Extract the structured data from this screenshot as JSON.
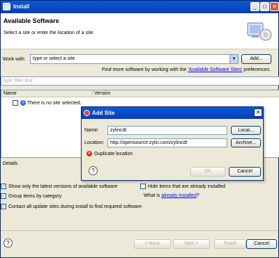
{
  "window": {
    "title": "Install",
    "minimize": "_",
    "maximize": "□",
    "close": "✕"
  },
  "header": {
    "title": "Available Software",
    "subtitle": "Select a site or enter the location of a site."
  },
  "work_with": {
    "label": "Work with:",
    "placeholder": "type or select a site",
    "add_button": "Add..."
  },
  "find_more": {
    "prefix": "Find more software by working with the ",
    "link": "'Available Software Sites'",
    "suffix": " preferences."
  },
  "filter": {
    "placeholder": "type filter text"
  },
  "table": {
    "columns": [
      "Name",
      "Version"
    ],
    "rows": [
      {
        "label": "There is no site selected."
      }
    ]
  },
  "details": {
    "label": "Details"
  },
  "options": {
    "show_latest": "Show only the latest versions of available software",
    "group_by_category": "Group items by category",
    "contact_update_sites": "Contact all update sites during install to find required software",
    "hide_installed": "Hide items that are already installed",
    "what_is_prefix": "What is ",
    "what_is_link": "already installed",
    "what_is_suffix": "?"
  },
  "wizard_buttons": {
    "back": "< Back",
    "next": "Next >",
    "finish": "Finish",
    "cancel": "Cancel"
  },
  "add_site_dialog": {
    "title": "Add Site",
    "name_label": "Name:",
    "name_value": "zylincdt",
    "location_label": "Location:",
    "location_value": "http://opensource.zylin.com/zylincdt",
    "local_button": "Local...",
    "archive_button": "Archive...",
    "error_message": "Duplicate location",
    "ok_button": "OK",
    "cancel_button": "Cancel",
    "close": "✕"
  },
  "colors": {
    "titlebar": "#0a3cb4",
    "link": "#0000ee",
    "error": "#d9301f"
  }
}
